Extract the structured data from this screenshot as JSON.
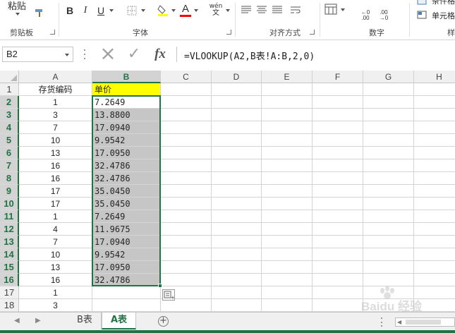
{
  "ribbon": {
    "clipboard": {
      "paste_label": "粘贴",
      "group_label": "剪贴板"
    },
    "font": {
      "bold": "B",
      "italic": "I",
      "underline": "U",
      "font_color_letter": "A",
      "phonetic": "wén",
      "group_label": "字体"
    },
    "alignment": {
      "group_label": "对齐方式"
    },
    "number": {
      "inc_decimal": "←0 .00",
      "dec_decimal": ".00 →0",
      "group_label": "数字"
    },
    "styles": {
      "cond_format_label": "条件格式",
      "cell_styles_label": "单元格",
      "group_label": "样式"
    },
    "colors": {
      "highlight": "#ffff00",
      "font": "#ff0000",
      "accent": "#217346"
    }
  },
  "formula_bar": {
    "name_box": "B2",
    "cancel_icon": "×",
    "enter_icon": "✓",
    "fx_label": "fx",
    "formula": "=VLOOKUP(A2,B表!A:B,2,0)"
  },
  "columns": [
    "A",
    "B",
    "C",
    "D",
    "E",
    "F",
    "G",
    "H"
  ],
  "rows": [
    {
      "num": "1",
      "a": "存货编码",
      "b": "单价"
    },
    {
      "num": "2",
      "a": "1",
      "b": "7.2649"
    },
    {
      "num": "3",
      "a": "3",
      "b": "13.8800"
    },
    {
      "num": "4",
      "a": "7",
      "b": "17.0940"
    },
    {
      "num": "5",
      "a": "10",
      "b": "9.9542"
    },
    {
      "num": "6",
      "a": "13",
      "b": "17.0950"
    },
    {
      "num": "7",
      "a": "16",
      "b": "32.4786"
    },
    {
      "num": "8",
      "a": "16",
      "b": "32.4786"
    },
    {
      "num": "9",
      "a": "17",
      "b": "35.0450"
    },
    {
      "num": "10",
      "a": "17",
      "b": "35.0450"
    },
    {
      "num": "11",
      "a": "1",
      "b": "7.2649"
    },
    {
      "num": "12",
      "a": "4",
      "b": "11.9675"
    },
    {
      "num": "13",
      "a": "7",
      "b": "17.0940"
    },
    {
      "num": "14",
      "a": "10",
      "b": "9.9542"
    },
    {
      "num": "15",
      "a": "13",
      "b": "17.0950"
    },
    {
      "num": "16",
      "a": "16",
      "b": "32.4786"
    },
    {
      "num": "17",
      "a": "1",
      "b": ""
    },
    {
      "num": "18",
      "a": "3",
      "b": ""
    }
  ],
  "sheet_tabs": [
    {
      "label": "B表",
      "active": false
    },
    {
      "label": "A表",
      "active": true
    }
  ],
  "watermark": "Baidu 经验"
}
